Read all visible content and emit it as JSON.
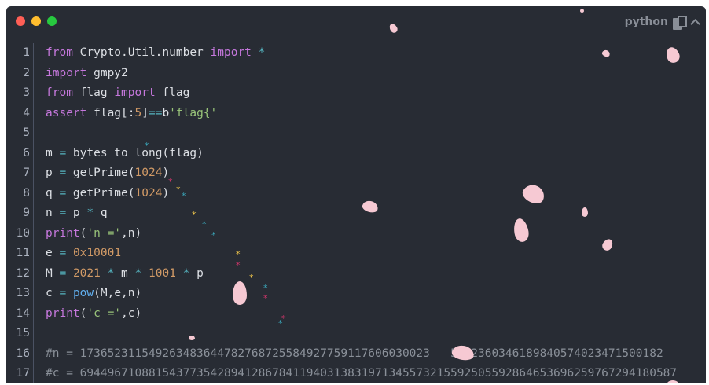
{
  "window": {
    "language": "python",
    "icons": [
      "close-dot",
      "minimize-dot",
      "maximize-dot",
      "copy-icon",
      "collapse-chevron-icon"
    ],
    "colors": {
      "red": "#ff5f56",
      "yellow": "#ffbd2e",
      "green": "#27c93f",
      "background": "#282c34"
    }
  },
  "code": {
    "line_numbers": [
      "1",
      "2",
      "3",
      "4",
      "5",
      "6",
      "7",
      "8",
      "9",
      "10",
      "11",
      "12",
      "13",
      "14",
      "15",
      "16",
      "17"
    ],
    "lines": [
      [
        {
          "t": "from",
          "c": "k"
        },
        {
          "t": " Crypto.Util.number ",
          "c": ""
        },
        {
          "t": "import",
          "c": "k"
        },
        {
          "t": " ",
          "c": ""
        },
        {
          "t": "*",
          "c": "o"
        }
      ],
      [
        {
          "t": "import",
          "c": "k"
        },
        {
          "t": " gmpy2",
          "c": ""
        }
      ],
      [
        {
          "t": "from",
          "c": "k"
        },
        {
          "t": " flag ",
          "c": ""
        },
        {
          "t": "import",
          "c": "k"
        },
        {
          "t": " flag",
          "c": ""
        }
      ],
      [
        {
          "t": "assert",
          "c": "k"
        },
        {
          "t": " flag[:",
          "c": ""
        },
        {
          "t": "5",
          "c": "n"
        },
        {
          "t": "]",
          "c": ""
        },
        {
          "t": "==",
          "c": "o"
        },
        {
          "t": "b",
          "c": ""
        },
        {
          "t": "'flag{'",
          "c": "s"
        }
      ],
      [],
      [
        {
          "t": "m ",
          "c": ""
        },
        {
          "t": "=",
          "c": "o"
        },
        {
          "t": " bytes_to_long(flag)",
          "c": ""
        }
      ],
      [
        {
          "t": "p ",
          "c": ""
        },
        {
          "t": "=",
          "c": "o"
        },
        {
          "t": " getPrime(",
          "c": ""
        },
        {
          "t": "1024",
          "c": "n"
        },
        {
          "t": ")",
          "c": ""
        }
      ],
      [
        {
          "t": "q ",
          "c": ""
        },
        {
          "t": "=",
          "c": "o"
        },
        {
          "t": " getPrime(",
          "c": ""
        },
        {
          "t": "1024",
          "c": "n"
        },
        {
          "t": ")",
          "c": ""
        }
      ],
      [
        {
          "t": "n ",
          "c": ""
        },
        {
          "t": "=",
          "c": "o"
        },
        {
          "t": " p ",
          "c": ""
        },
        {
          "t": "*",
          "c": "o"
        },
        {
          "t": " q",
          "c": ""
        }
      ],
      [
        {
          "t": "print",
          "c": "k"
        },
        {
          "t": "(",
          "c": ""
        },
        {
          "t": "'n ='",
          "c": "s"
        },
        {
          "t": ",n)",
          "c": ""
        }
      ],
      [
        {
          "t": "e ",
          "c": ""
        },
        {
          "t": "=",
          "c": "o"
        },
        {
          "t": " ",
          "c": ""
        },
        {
          "t": "0x10001",
          "c": "n"
        }
      ],
      [
        {
          "t": "M ",
          "c": ""
        },
        {
          "t": "=",
          "c": "o"
        },
        {
          "t": " ",
          "c": ""
        },
        {
          "t": "2021",
          "c": "n"
        },
        {
          "t": " ",
          "c": ""
        },
        {
          "t": "*",
          "c": "o"
        },
        {
          "t": " m ",
          "c": ""
        },
        {
          "t": "*",
          "c": "o"
        },
        {
          "t": " ",
          "c": ""
        },
        {
          "t": "1001",
          "c": "n"
        },
        {
          "t": " ",
          "c": ""
        },
        {
          "t": "*",
          "c": "o"
        },
        {
          "t": " p",
          "c": ""
        }
      ],
      [
        {
          "t": "c ",
          "c": ""
        },
        {
          "t": "=",
          "c": "o"
        },
        {
          "t": " ",
          "c": ""
        },
        {
          "t": "pow",
          "c": "f"
        },
        {
          "t": "(M,e,n)",
          "c": ""
        }
      ],
      [
        {
          "t": "print",
          "c": "k"
        },
        {
          "t": "(",
          "c": ""
        },
        {
          "t": "'c ='",
          "c": "s"
        },
        {
          "t": ",c)",
          "c": ""
        }
      ],
      [],
      [
        {
          "t": "#n = 173652311549263483644782768725584927759117606030023",
          "c": "c"
        },
        {
          "t": "   ",
          "c": ""
        },
        {
          "t": "5372360346189840574023471500182",
          "c": "c"
        }
      ],
      [
        {
          "t": "#c = 694496710881543773542894128678411940313831971345573215592505592864653696259767294180587",
          "c": "c"
        }
      ]
    ]
  }
}
